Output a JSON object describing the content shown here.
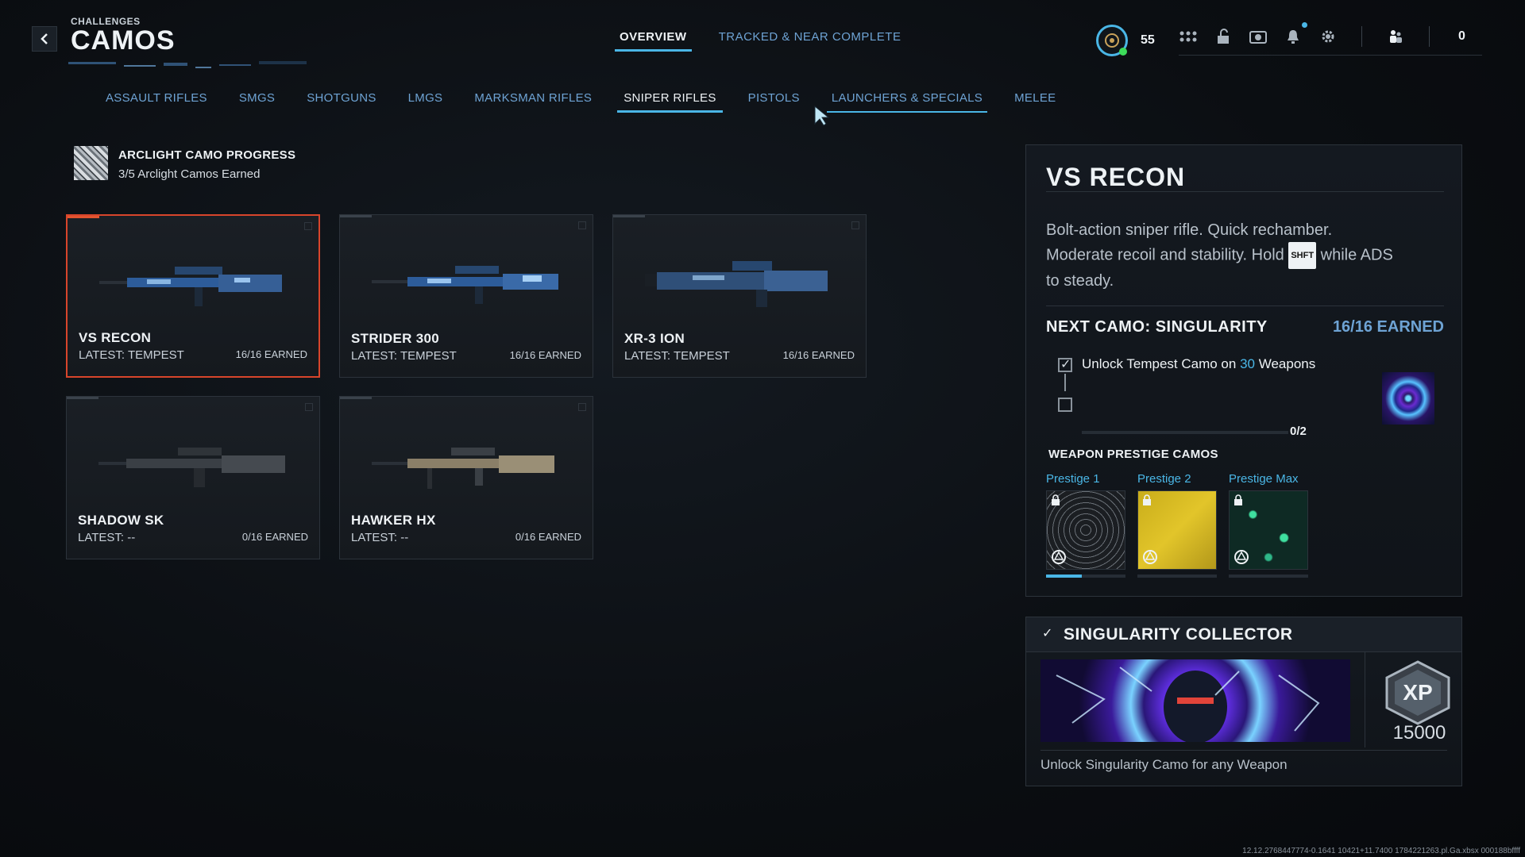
{
  "header": {
    "section": "CHALLENGES",
    "title": "CAMOS",
    "tabs": [
      {
        "label": "OVERVIEW",
        "active": true
      },
      {
        "label": "TRACKED & NEAR COMPLETE",
        "active": false
      }
    ]
  },
  "hud": {
    "level": "55",
    "icons": [
      "grid-icon",
      "unlock-icon",
      "camera-icon",
      "bell-icon",
      "gear-icon",
      "friends-icon"
    ],
    "friends_count": "0"
  },
  "categories": [
    {
      "label": "ASSAULT RIFLES",
      "active": false
    },
    {
      "label": "SMGS",
      "active": false
    },
    {
      "label": "SHOTGUNS",
      "active": false
    },
    {
      "label": "LMGS",
      "active": false
    },
    {
      "label": "MARKSMAN RIFLES",
      "active": false
    },
    {
      "label": "SNIPER RIFLES",
      "active": true
    },
    {
      "label": "PISTOLS",
      "active": false
    },
    {
      "label": "LAUNCHERS & SPECIALS",
      "active": false
    },
    {
      "label": "MELEE",
      "active": false
    }
  ],
  "arclight": {
    "title": "ARCLIGHT CAMO PROGRESS",
    "subtitle": "3/5 Arclight Camos Earned"
  },
  "weapons": [
    {
      "name": "VS RECON",
      "latest": "LATEST: TEMPEST",
      "earned": "16/16 EARNED",
      "selected": true
    },
    {
      "name": "STRIDER 300",
      "latest": "LATEST: TEMPEST",
      "earned": "16/16 EARNED",
      "selected": false
    },
    {
      "name": "XR-3 ION",
      "latest": "LATEST: TEMPEST",
      "earned": "16/16 EARNED",
      "selected": false
    },
    {
      "name": "SHADOW SK",
      "latest": "LATEST: --",
      "earned": "0/16 EARNED",
      "selected": false
    },
    {
      "name": "HAWKER HX",
      "latest": "LATEST: --",
      "earned": "0/16 EARNED",
      "selected": false
    }
  ],
  "detail": {
    "title": "VS RECON",
    "desc_1": "Bolt-action sniper rifle.  Quick rechamber.",
    "desc_2a": "Moderate recoil and stability.  Hold",
    "key": "SHFT",
    "desc_2b": "while ADS",
    "desc_3": "to steady.",
    "next_camo": "NEXT CAMO: SINGULARITY",
    "next_earned": "16/16 EARNED",
    "task_prefix": "Unlock Tempest Camo on",
    "task_highlight": "30",
    "task_suffix": "Weapons",
    "task_progress": "0/2",
    "task_fraction": 0,
    "prestige_heading": "WEAPON PRESTIGE CAMOS",
    "prestige": [
      {
        "label": "Prestige 1",
        "progress": 0.45
      },
      {
        "label": "Prestige 2",
        "progress": 0
      },
      {
        "label": "Prestige Max",
        "progress": 0
      }
    ]
  },
  "collector": {
    "title": "SINGULARITY COLLECTOR",
    "xp_label": "XP",
    "xp_value": "15000",
    "desc": "Unlock Singularity Camo for any Weapon"
  },
  "build_string": "12.12.2768447774-0.1641 10421+11.7400 1784221263.pl.Ga.xbsx 000188bffff"
}
